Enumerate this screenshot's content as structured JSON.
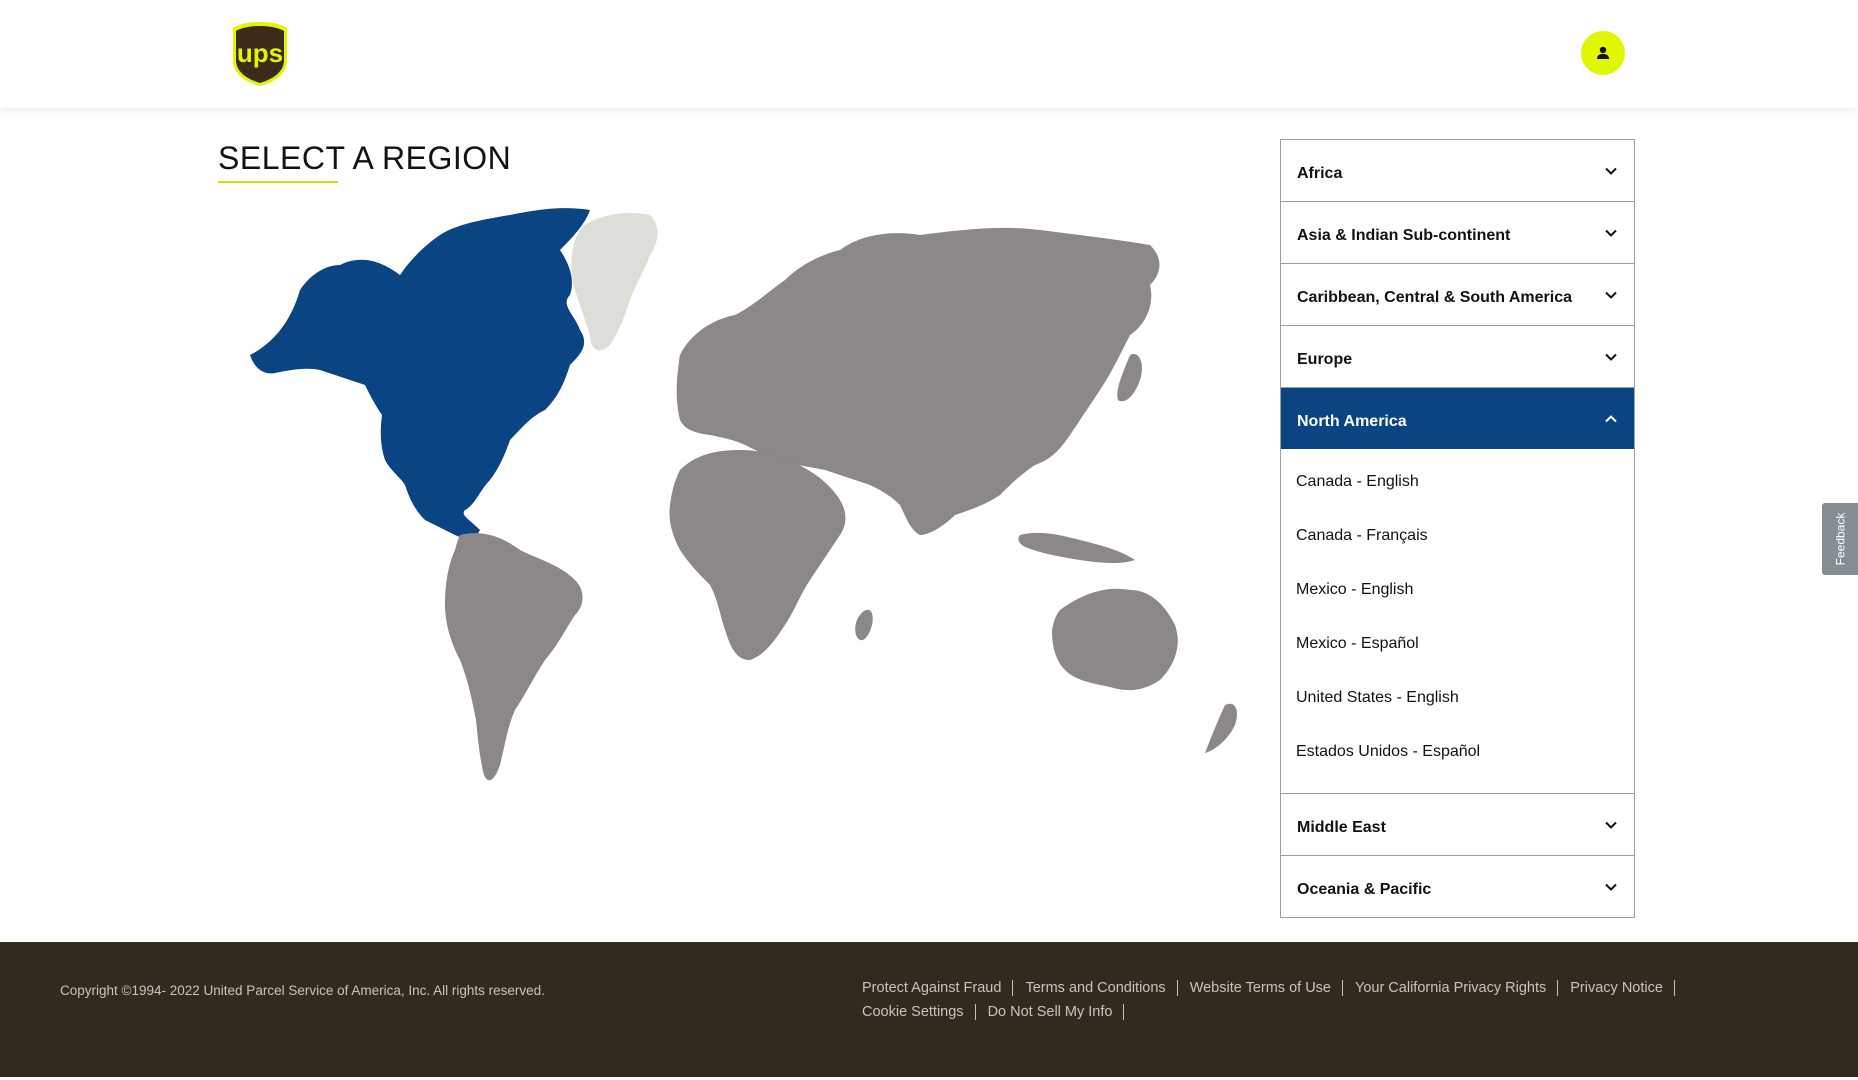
{
  "header": {
    "logo_text": "ups",
    "profile_label": "Profile"
  },
  "page": {
    "title": "SELECT A REGION"
  },
  "regions": [
    {
      "label": "Africa",
      "open": false
    },
    {
      "label": "Asia & Indian Sub-continent",
      "open": false
    },
    {
      "label": "Caribbean, Central & South America",
      "open": false
    },
    {
      "label": "Europe",
      "open": false
    },
    {
      "label": "North America",
      "open": true,
      "links": [
        "Canada - English",
        "Canada - Français",
        "Mexico - English",
        "Mexico - Español",
        "United States - English",
        "Estados Unidos - Español"
      ]
    },
    {
      "label": "Middle East",
      "open": false
    },
    {
      "label": "Oceania & Pacific",
      "open": false
    }
  ],
  "feedback": {
    "label": "Feedback"
  },
  "footer": {
    "copyright": "Copyright ©1994- 2022  United Parcel Service of America, Inc. All rights reserved.",
    "links": [
      "Protect Against Fraud",
      "Terms and Conditions",
      "Website Terms of Use",
      "Your California Privacy Rights",
      "Privacy Notice",
      "Cookie Settings",
      "Do Not Sell My Info"
    ]
  },
  "colors": {
    "highlight_region": "#0b4482",
    "other_regions": "#8b8887",
    "greenland": "#deddd8",
    "accent": "#dff800",
    "footer_bg": "#322a1d"
  }
}
